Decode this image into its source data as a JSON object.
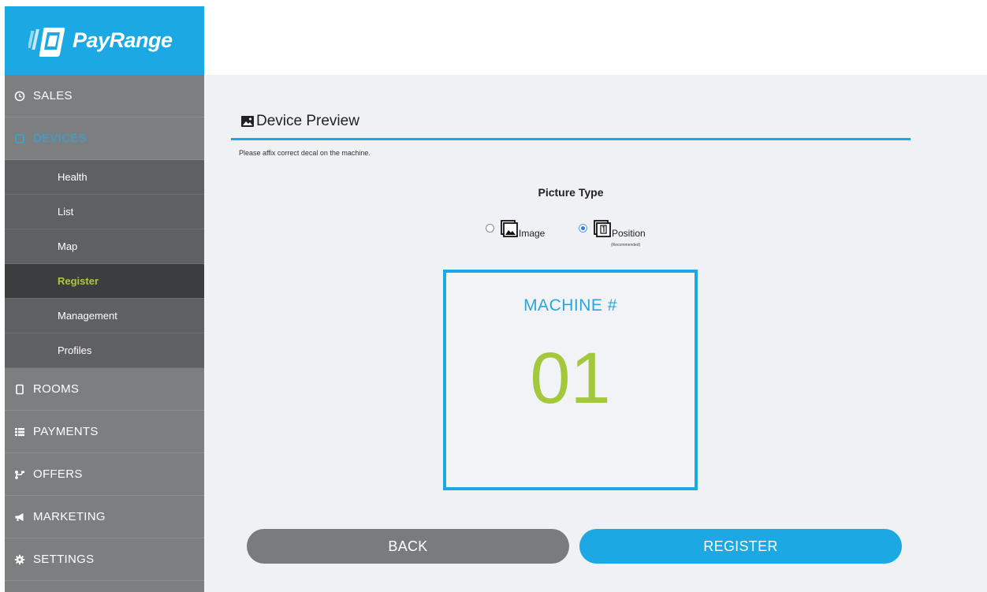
{
  "brand": {
    "name": "PayRange",
    "color": "#1ba8e3"
  },
  "sidebar": {
    "items": [
      {
        "label": "SALES",
        "icon": "clock-icon"
      },
      {
        "label": "DEVICES",
        "icon": "device-icon",
        "active": true
      },
      {
        "label": "ROOMS",
        "icon": "tablet-icon"
      },
      {
        "label": "PAYMENTS",
        "icon": "list-icon"
      },
      {
        "label": "OFFERS",
        "icon": "offers-icon"
      },
      {
        "label": "MARKETING",
        "icon": "megaphone-icon"
      },
      {
        "label": "SETTINGS",
        "icon": "gear-icon"
      }
    ],
    "devices_submenu": [
      "Health",
      "List",
      "Map",
      "Register",
      "Management",
      "Profiles"
    ],
    "current_subitem": "Register"
  },
  "main": {
    "section_title": "Device Preview",
    "hint": "Please affix correct decal on the machine.",
    "picture_type": {
      "label": "Picture Type",
      "options": [
        {
          "label": "Image",
          "icon": "image-icon",
          "selected": false
        },
        {
          "label": "Position",
          "icon": "position-icon",
          "selected": true
        }
      ],
      "recommended_note": "(Recommended)"
    },
    "machine_label": "MACHINE #",
    "machine_number": "01",
    "buttons": {
      "back": "BACK",
      "register": "REGISTER"
    }
  },
  "colors": {
    "accent": "#1ba8e3",
    "machine_number": "#a3c83c",
    "current_subitem": "#a9c93a",
    "sidebar": "#7d7e80",
    "submenu": "#5f6062",
    "back_button": "#7a7b7d"
  }
}
